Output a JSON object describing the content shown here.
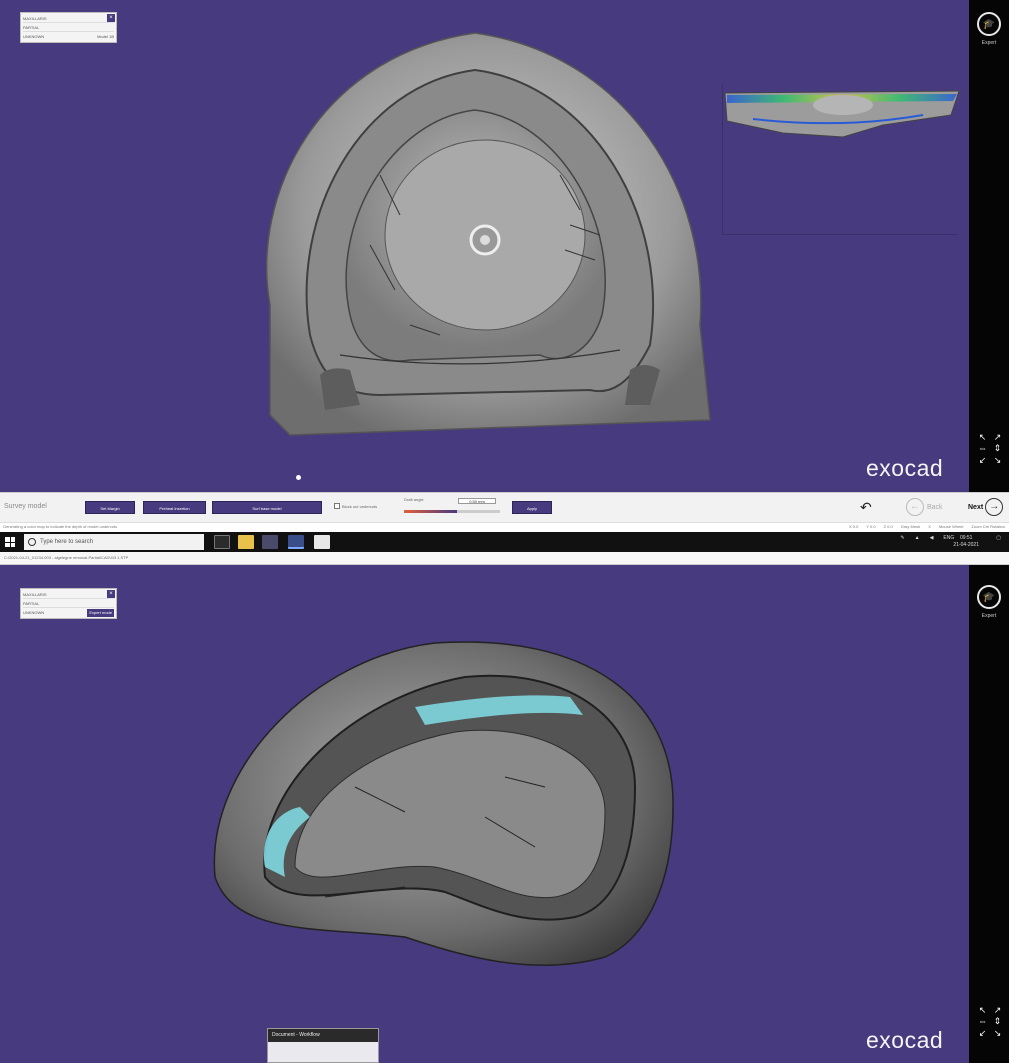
{
  "app": {
    "logo_text": "exocad"
  },
  "top_view": {
    "info_rows": [
      "MAXILLARIS",
      "PARTIAL",
      "UNKNOWN"
    ],
    "info_row3_right": "Model 1B"
  },
  "bottom_view": {
    "info_rows": [
      "MAXILLARIS",
      "PARTIAL",
      "UNKNOWN"
    ],
    "info_row3_tag": "Expert mode"
  },
  "right_rail": {
    "wizard_label": "Expert"
  },
  "toolbar": {
    "step_label": "Survey model",
    "buttons": [
      "Set Margin",
      "Preheat insertion",
      "Surf base model"
    ],
    "checkbox_label": "Block out undercuts",
    "angle_label": "Draft angle",
    "angle_value": "0.50 mm",
    "angle_fraction": 0.55,
    "apply_label": "Apply",
    "back_label": "Back",
    "next_label": "Next"
  },
  "status": {
    "message": "Generating a color map to indicate the depth of model undercuts",
    "indicators": [
      "X 0.0",
      "Y 0.0",
      "Z 0.0",
      "Gray Mesh",
      "X",
      "Mouse Wheel",
      "Zoom Ctrl Rotation"
    ]
  },
  "taskbar": {
    "search_placeholder": "Type here to search",
    "clock_time": "09:51",
    "clock_date": "21-04-2021",
    "tray_lang": "ENG"
  },
  "path_bar": {
    "path": "C:\\2021-04-21_01234-003 - algelegne removal-Partial\\CAD\\4\\3 1.STP"
  },
  "popup": {
    "title": "Document - Workflow"
  }
}
